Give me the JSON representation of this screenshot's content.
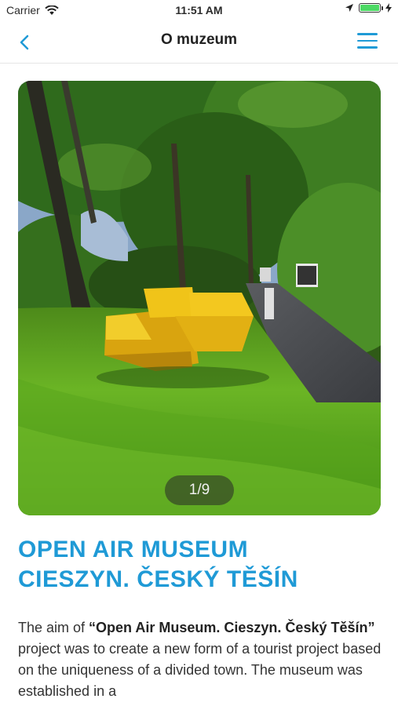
{
  "status_bar": {
    "carrier": "Carrier",
    "time": "11:51 AM"
  },
  "nav": {
    "title": "O muzeum"
  },
  "gallery": {
    "counter": "1/9"
  },
  "content": {
    "heading_line1": "OPEN AIR MUSEUM",
    "heading_line2": "CIESZYN. ČESKÝ TĚŠÍN",
    "intro_prefix": "The aim of ",
    "intro_bold": "“Open Air Museum. Cieszyn. Český Těšín”",
    "intro_rest": " project was to create a new form of a tourist project based on the uniqueness of a divided town. The museum was established in a"
  },
  "colors": {
    "accent": "#1f9ad6",
    "battery": "#4cd964"
  },
  "icons": {
    "back": "chevron-left-icon",
    "menu": "hamburger-menu-icon",
    "wifi": "wifi-icon",
    "location": "location-arrow-icon",
    "charging": "bolt-icon"
  }
}
